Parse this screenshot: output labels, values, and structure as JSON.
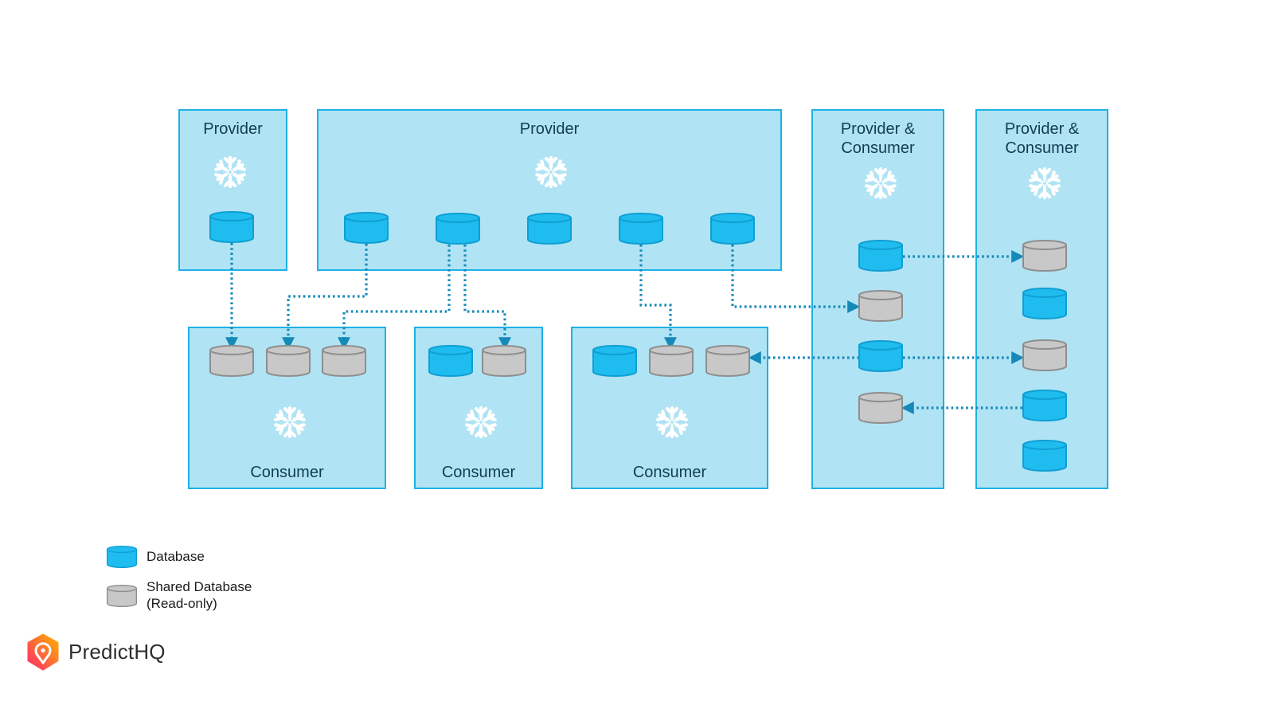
{
  "boxes": [
    {
      "id": "provider-1",
      "label": "Provider",
      "role": "provider"
    },
    {
      "id": "provider-2",
      "label": "Provider",
      "role": "provider"
    },
    {
      "id": "provider-consumer-1",
      "label": "Provider &\nConsumer",
      "role": "provider-consumer"
    },
    {
      "id": "provider-consumer-2",
      "label": "Provider &\nConsumer",
      "role": "provider-consumer"
    },
    {
      "id": "consumer-1",
      "label": "Consumer",
      "role": "consumer"
    },
    {
      "id": "consumer-2",
      "label": "Consumer",
      "role": "consumer"
    },
    {
      "id": "consumer-3",
      "label": "Consumer",
      "role": "consumer"
    }
  ],
  "databases": {
    "provider-1": [
      "database"
    ],
    "provider-2": [
      "database",
      "database",
      "database",
      "database",
      "database"
    ],
    "provider-consumer-1": [
      "database",
      "shared",
      "database",
      "shared"
    ],
    "provider-consumer-2": [
      "shared",
      "database",
      "shared",
      "database",
      "database"
    ],
    "consumer-1": [
      "shared",
      "shared",
      "shared"
    ],
    "consumer-2": [
      "database",
      "shared"
    ],
    "consumer-3": [
      "database",
      "shared",
      "shared"
    ]
  },
  "connections": [
    {
      "from": "provider-1.db1",
      "to": "consumer-1.db1"
    },
    {
      "from": "provider-2.db1",
      "to": "consumer-1.db2"
    },
    {
      "from": "provider-2.db2",
      "to": "consumer-1.db3"
    },
    {
      "from": "provider-2.db2",
      "to": "consumer-2.db2"
    },
    {
      "from": "provider-2.db4",
      "to": "consumer-3.db2"
    },
    {
      "from": "provider-2.db5",
      "to": "provider-consumer-1.db2"
    },
    {
      "from": "provider-consumer-1.db1",
      "to": "provider-consumer-2.db1"
    },
    {
      "from": "provider-consumer-1.db3",
      "to": "provider-consumer-2.db3"
    },
    {
      "from": "provider-consumer-1.db3",
      "to": "consumer-3.db3"
    },
    {
      "from": "provider-consumer-2.db4",
      "to": "provider-consumer-1.db4"
    }
  ],
  "legend": {
    "database": "Database",
    "shared": "Shared Database\n(Read-only)"
  },
  "brand": {
    "name": "PredictHQ"
  },
  "colors": {
    "box_fill": "#b0e3f4",
    "box_border": "#1fb1e3",
    "database_fill": "#1fbcef",
    "database_stroke": "#0f9fd3",
    "shared_fill": "#c8c8c8",
    "shared_stroke": "#8e8e8e",
    "connector": "#1589b8",
    "label_text": "#123e52"
  }
}
